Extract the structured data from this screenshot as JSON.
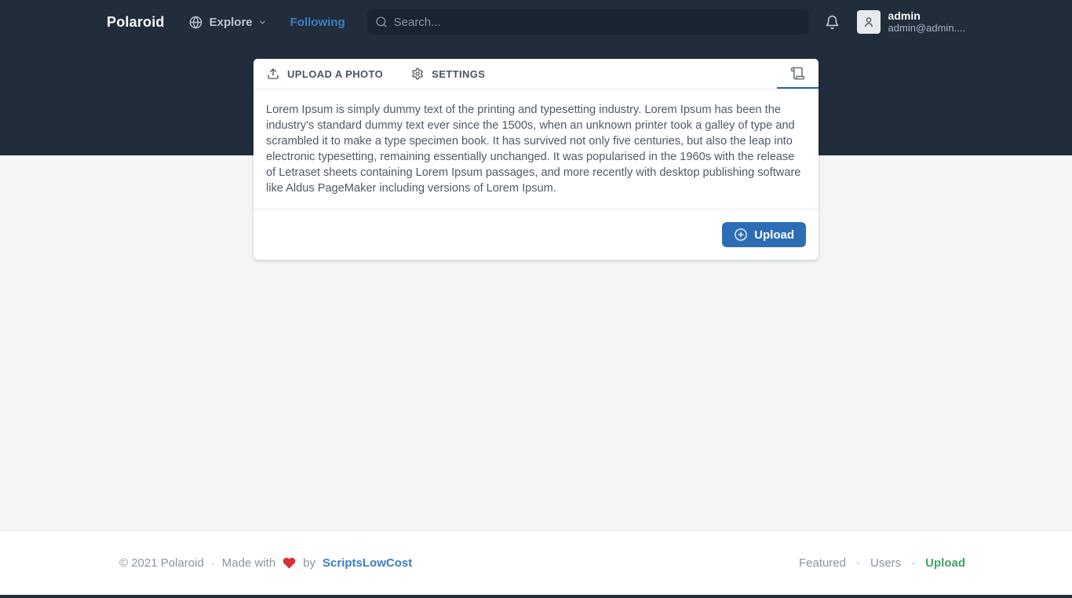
{
  "navbar": {
    "brand": "Polaroid",
    "explore_label": "Explore",
    "following_label": "Following",
    "search_placeholder": "Search...",
    "user": {
      "name": "admin",
      "email": "admin@admin...."
    }
  },
  "card": {
    "tabs": [
      {
        "label": "UPLOAD A PHOTO",
        "icon": "upload-icon"
      },
      {
        "label": "SETTINGS",
        "icon": "gear-icon"
      },
      {
        "label": "",
        "icon": "scroll-icon",
        "active": true
      }
    ],
    "body_text": "Lorem Ipsum is simply dummy text of the printing and typesetting industry. Lorem Ipsum has been the industry's standard dummy text ever since the 1500s, when an unknown printer took a galley of type and scrambled it to make a type specimen book. It has survived not only five centuries, but also the leap into electronic typesetting, remaining essentially unchanged. It was popularised in the 1960s with the release of Letraset sheets containing Lorem Ipsum passages, and more recently with desktop publishing software like Aldus PageMaker including versions of Lorem Ipsum.",
    "upload_button_label": "Upload"
  },
  "footer": {
    "copyright": "© 2021 Polaroid",
    "sep": "·",
    "made_with": "Made with",
    "by": "by",
    "credit": "ScriptsLowCost",
    "links": [
      {
        "label": "Featured"
      },
      {
        "label": "Users"
      },
      {
        "label": "Upload"
      }
    ]
  },
  "icons": {
    "globe-icon": "globe",
    "chevron-down-icon": "chevron-down",
    "search-icon": "magnifier",
    "bell-icon": "notification bell",
    "user-icon": "person silhouette",
    "upload-icon": "tray with up arrow",
    "gear-icon": "settings cog",
    "scroll-icon": "paper scroll",
    "plus-circle-icon": "circled plus",
    "heart-icon": "red heart"
  },
  "colors": {
    "navbar_bg": "#222d3c",
    "search_bg": "#1a2430",
    "page_bg": "#f4f6f8",
    "following_blue": "#3f7ec0",
    "button_blue": "#2d6db6",
    "tab_active_underline": "#2a6396",
    "credit_blue": "#3c7dc0",
    "upload_green": "#3fa262",
    "heart_red": "#dd2e2e"
  }
}
